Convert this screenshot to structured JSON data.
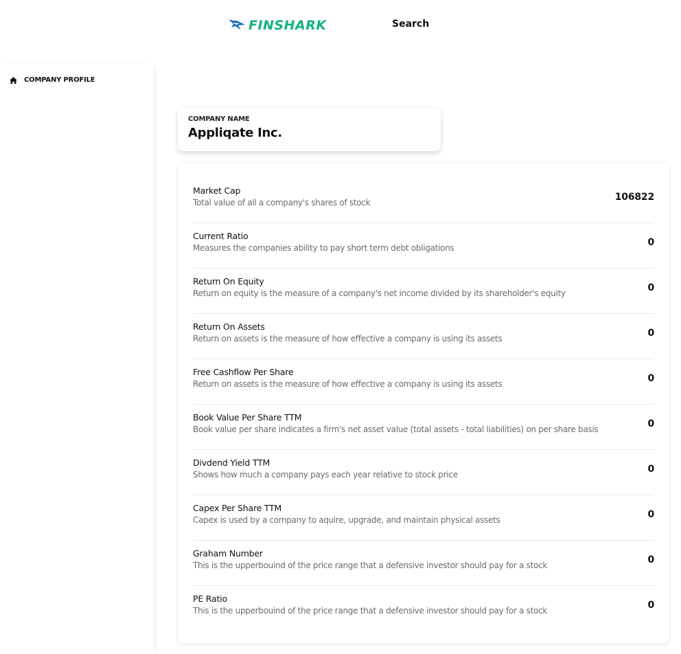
{
  "header": {
    "logo_text": "FINSHARK",
    "logo_icon": "shark-icon",
    "search_label": "Search",
    "brand_color": "#13b37e",
    "logo_mark_color": "#1e6fb8"
  },
  "sidebar": {
    "items": [
      {
        "label": "COMPANY PROFILE",
        "icon": "home-icon"
      }
    ]
  },
  "company": {
    "label": "COMPANY NAME",
    "name": "Appliqate Inc."
  },
  "metrics": [
    {
      "title": "Market Cap",
      "description": "Total value of all a company's shares of stock",
      "value": "106822"
    },
    {
      "title": "Current Ratio",
      "description": "Measures the companies ability to pay short term debt obligations",
      "value": "0"
    },
    {
      "title": "Return On Equity",
      "description": "Return on equity is the measure of a company's net income divided by its shareholder's equity",
      "value": "0"
    },
    {
      "title": "Return On Assets",
      "description": "Return on assets is the measure of how effective a company is using its assets",
      "value": "0"
    },
    {
      "title": "Free Cashflow Per Share",
      "description": "Return on assets is the measure of how effective a company is using its assets",
      "value": "0"
    },
    {
      "title": "Book Value Per Share TTM",
      "description": "Book value per share indicates a firm's net asset value (total assets - total liabilities) on per share basis",
      "value": "0"
    },
    {
      "title": "Divdend Yield TTM",
      "description": "Shows how much a company pays each year relative to stock price",
      "value": "0"
    },
    {
      "title": "Capex Per Share TTM",
      "description": "Capex is used by a company to aquire, upgrade, and maintain physical assets",
      "value": "0"
    },
    {
      "title": "Graham Number",
      "description": "This is the upperbouind of the price range that a defensive investor should pay for a stock",
      "value": "0"
    },
    {
      "title": "PE Ratio",
      "description": "This is the upperbouind of the price range that a defensive investor should pay for a stock",
      "value": "0"
    }
  ]
}
